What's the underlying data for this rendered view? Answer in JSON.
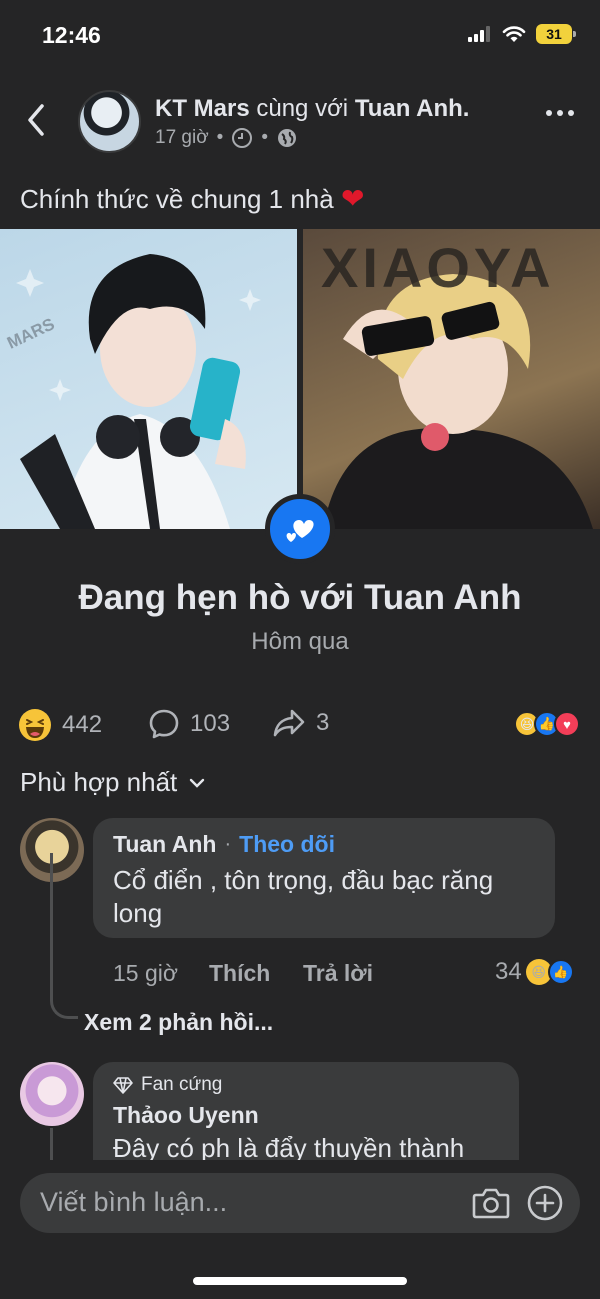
{
  "status": {
    "time": "12:46",
    "battery": "31"
  },
  "post": {
    "author": "KT Mars",
    "with_text": "cùng với",
    "tagged": "Tuan Anh.",
    "time": "17 giờ",
    "caption": "Chính thức về chung 1 nhà",
    "left_image_text": "MARS",
    "right_image_text": "XIAOYA"
  },
  "event": {
    "title": "Đang hẹn hò với Tuan Anh",
    "when": "Hôm qua"
  },
  "stats": {
    "reactions": "442",
    "comments": "103",
    "shares": "3"
  },
  "sort": {
    "label": "Phù hợp nhất"
  },
  "comments": [
    {
      "name": "Tuan Anh",
      "follow": "Theo dõi",
      "text_line1": "Cổ điển , tôn trọng, đầu bạc răng",
      "text_line2": "long",
      "time": "15 giờ",
      "like": "Thích",
      "reply": "Trả lời",
      "reaction_count": "34",
      "view_replies": "Xem 2 phản hồi..."
    },
    {
      "badge": "Fan cứng",
      "name": "Thảoo Uyenn",
      "text_line1": "Đây có ph là đẩy thuyền thành"
    }
  ],
  "composer": {
    "placeholder": "Viết bình luận..."
  },
  "colors": {
    "background": "#252526",
    "bubble": "#3a3b3c",
    "accent_blue": "#1877f2",
    "link_blue": "#4e9cf5"
  }
}
